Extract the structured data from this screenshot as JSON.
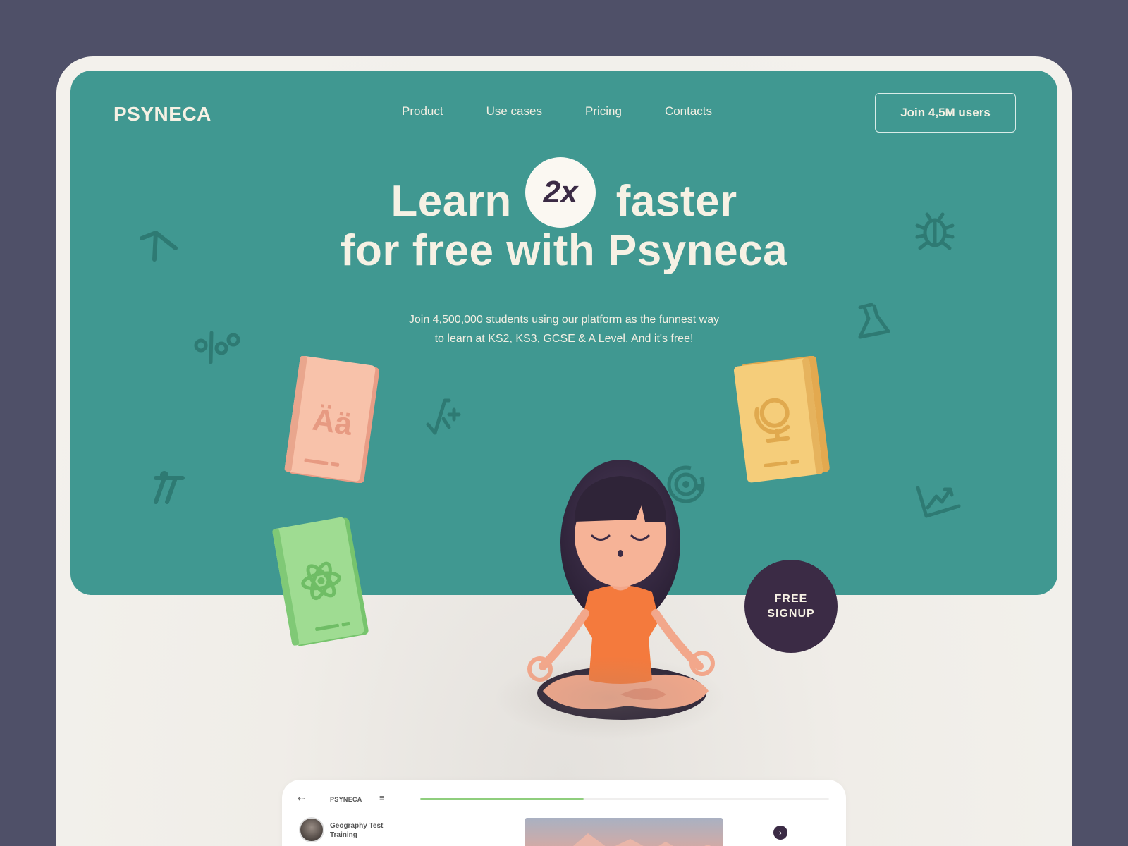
{
  "brand": {
    "logo": "PSYNECA"
  },
  "nav": {
    "items": [
      "Product",
      "Use cases",
      "Pricing",
      "Contacts"
    ]
  },
  "header": {
    "cta_label": "Join 4,5M users"
  },
  "hero": {
    "headline_part1": "Learn",
    "multiplier": "2x",
    "headline_part2": "faster",
    "headline_line2": "for free with Psyneca",
    "subtitle_line1": "Join 4,500,000 students using our platform as the funnest way",
    "subtitle_line2": "to learn at KS2, KS3, GCSE & A Level. And it's free!",
    "signup_line1": "FREE",
    "signup_line2": "SIGNUP"
  },
  "books": {
    "language_glyph": "Ää"
  },
  "app_preview": {
    "brand": "PSYNECA",
    "course_title": "Geography Test Training",
    "progress": 0.4
  },
  "colors": {
    "page_bg": "#4f5068",
    "hero_bg": "#409891",
    "accent_dark": "#3b2b45",
    "cream_text": "#f6f1e4",
    "book_pink": "#f6b9a0",
    "book_green": "#93d58a",
    "book_yellow": "#f2c56d",
    "shirt_orange": "#f47a3d",
    "progress_green": "#8fce7d"
  },
  "icons": [
    "caret-icon",
    "percent-icon",
    "sqrt-plus-icon",
    "pi-icon",
    "bug-icon",
    "flask-icon",
    "target-icon",
    "chart-up-icon",
    "atom-icon",
    "globe-icon",
    "back-icon",
    "menu-icon",
    "chevron-right-icon"
  ]
}
